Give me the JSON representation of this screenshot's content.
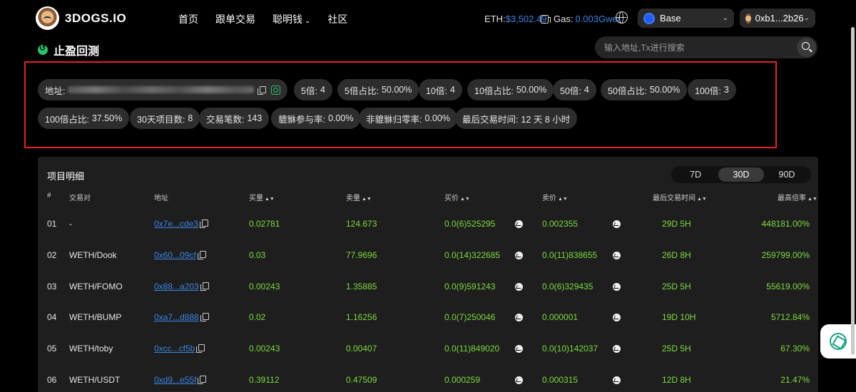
{
  "brand": {
    "name": "3DOGS.IO"
  },
  "nav": {
    "items": [
      {
        "label": "首页"
      },
      {
        "label": "跟单交易"
      },
      {
        "label": "聪明钱"
      },
      {
        "label": "社区"
      }
    ]
  },
  "header": {
    "eth_label": "ETH:",
    "eth_price": "$3,502.49",
    "gas_label": "Gas:",
    "gas_value": "0.003Gwei",
    "chain": "Base",
    "wallet": "0xb1...2b26"
  },
  "page": {
    "title": "止盈回测",
    "search_placeholder": "输入地址,Tx进行搜索"
  },
  "stats": {
    "address_label": "地址:",
    "chips": [
      {
        "label": "5倍:",
        "value": "4"
      },
      {
        "label": "5倍占比:",
        "value": "50.00%"
      },
      {
        "label": "10倍:",
        "value": "4"
      },
      {
        "label": "10倍占比:",
        "value": "50.00%"
      },
      {
        "label": "50倍:",
        "value": "4"
      },
      {
        "label": "50倍占比:",
        "value": "50.00%"
      },
      {
        "label": "100倍:",
        "value": "3"
      },
      {
        "label": "100倍占比:",
        "value": "37.50%"
      },
      {
        "label": "30天项目数:",
        "value": "8"
      },
      {
        "label": "交易笔数:",
        "value": "143"
      },
      {
        "label": "貔貅参与率:",
        "value": "0.00%"
      },
      {
        "label": "非貔貅归零率:",
        "value": "0.00%"
      },
      {
        "label": "最后交易时间:",
        "value": "12 天 8 小时"
      }
    ]
  },
  "details": {
    "title": "项目明细",
    "ranges": [
      "7D",
      "30D",
      "90D"
    ],
    "active_range": "30D",
    "columns": [
      "#",
      "交易对",
      "地址",
      "买量",
      "卖量",
      "买价",
      "卖价",
      "最后交易时间",
      "最高倍率"
    ],
    "rows": [
      {
        "idx": "01",
        "pair": "-",
        "addr": "0x7e...cde3",
        "buy_qty": "0.02781",
        "sell_qty": "124.673",
        "buy_price": "0.0(6)525295",
        "sell_price": "0.002355",
        "last": "29D 5H",
        "max": "448181.00%"
      },
      {
        "idx": "02",
        "pair": "WETH/Dook",
        "addr": "0x60...09cf",
        "buy_qty": "0.03",
        "sell_qty": "77.9696",
        "buy_price": "0.0(14)322685",
        "sell_price": "0.0(11)838655",
        "last": "26D 8H",
        "max": "259799.00%"
      },
      {
        "idx": "03",
        "pair": "WETH/FOMO",
        "addr": "0x88...a203",
        "buy_qty": "0.00243",
        "sell_qty": "1.35885",
        "buy_price": "0.0(9)591243",
        "sell_price": "0.0(6)329435",
        "last": "25D 5H",
        "max": "55619.00%"
      },
      {
        "idx": "04",
        "pair": "WETH/BUMP",
        "addr": "0xa7...d888",
        "buy_qty": "0.02",
        "sell_qty": "1.16256",
        "buy_price": "0.0(7)250046",
        "sell_price": "0.000001",
        "last": "19D 10H",
        "max": "5712.84%"
      },
      {
        "idx": "05",
        "pair": "WETH/toby",
        "addr": "0xcc...cf5b",
        "buy_qty": "0.00243",
        "sell_qty": "0.00407",
        "buy_price": "0.0(11)849020",
        "sell_price": "0.0(10)142037",
        "last": "25D 5H",
        "max": "67.30%"
      },
      {
        "idx": "06",
        "pair": "WETH/USDT",
        "addr": "0xd9...e55f",
        "buy_qty": "0.39112",
        "sell_qty": "0.47509",
        "buy_price": "0.000259",
        "sell_price": "0.000315",
        "last": "12D 8H",
        "max": "21.47%"
      }
    ]
  }
}
